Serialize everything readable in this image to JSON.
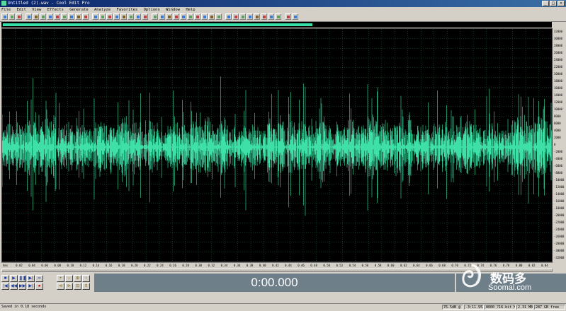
{
  "window": {
    "title": "Untitled (2).wav - Cool Edit Pro"
  },
  "menu": [
    "File",
    "Edit",
    "View",
    "Effects",
    "Generate",
    "Analyze",
    "Favorites",
    "Options",
    "Window",
    "Help"
  ],
  "overview": {
    "visible_fraction": 0.565
  },
  "colors": {
    "waveform": "#3ee0a8",
    "grid": "#1f6b3a",
    "background": "#000000"
  },
  "amplitude_scale": [
    "32000",
    "30000",
    "28000",
    "26000",
    "24000",
    "22000",
    "20000",
    "18000",
    "16000",
    "14000",
    "12000",
    "10000",
    "8000",
    "6000",
    "4000",
    "2000",
    "0",
    "-2000",
    "-4000",
    "-6000",
    "-8000",
    "-10000",
    "-12000",
    "-14000",
    "-16000",
    "-18000",
    "-20000",
    "-22000",
    "-24000",
    "-26000",
    "-28000",
    "-30000",
    "-32000"
  ],
  "time_ruler": [
    "hms",
    "0.02",
    "0.04",
    "0.06",
    "0.08",
    "0.10",
    "0.12",
    "0.14",
    "0.16",
    "0.18",
    "0.20",
    "0.22",
    "0.24",
    "0.26",
    "0.28",
    "0.30",
    "0.32",
    "0.34",
    "0.36",
    "0.38",
    "0.40",
    "0.42",
    "0.44",
    "0.46",
    "0.48",
    "0.50",
    "0.52",
    "0.54",
    "0.56",
    "0.58",
    "0.60",
    "0.62",
    "0.64",
    "0.66",
    "0.68",
    "0.70",
    "0.72",
    "0.74",
    "0.76",
    "0.78",
    "0.80",
    "0.82",
    "0.84"
  ],
  "transport": {
    "time": "0:00.000"
  },
  "watermark": {
    "title": "数码多",
    "url": "Soomal.com"
  },
  "status": {
    "left": "Saved in 0.18 seconds",
    "cells": [
      "76.5dB @",
      "-3:11.952",
      "8000 ?16-bit Mono",
      "2.31 MB",
      "287 GB free"
    ]
  }
}
